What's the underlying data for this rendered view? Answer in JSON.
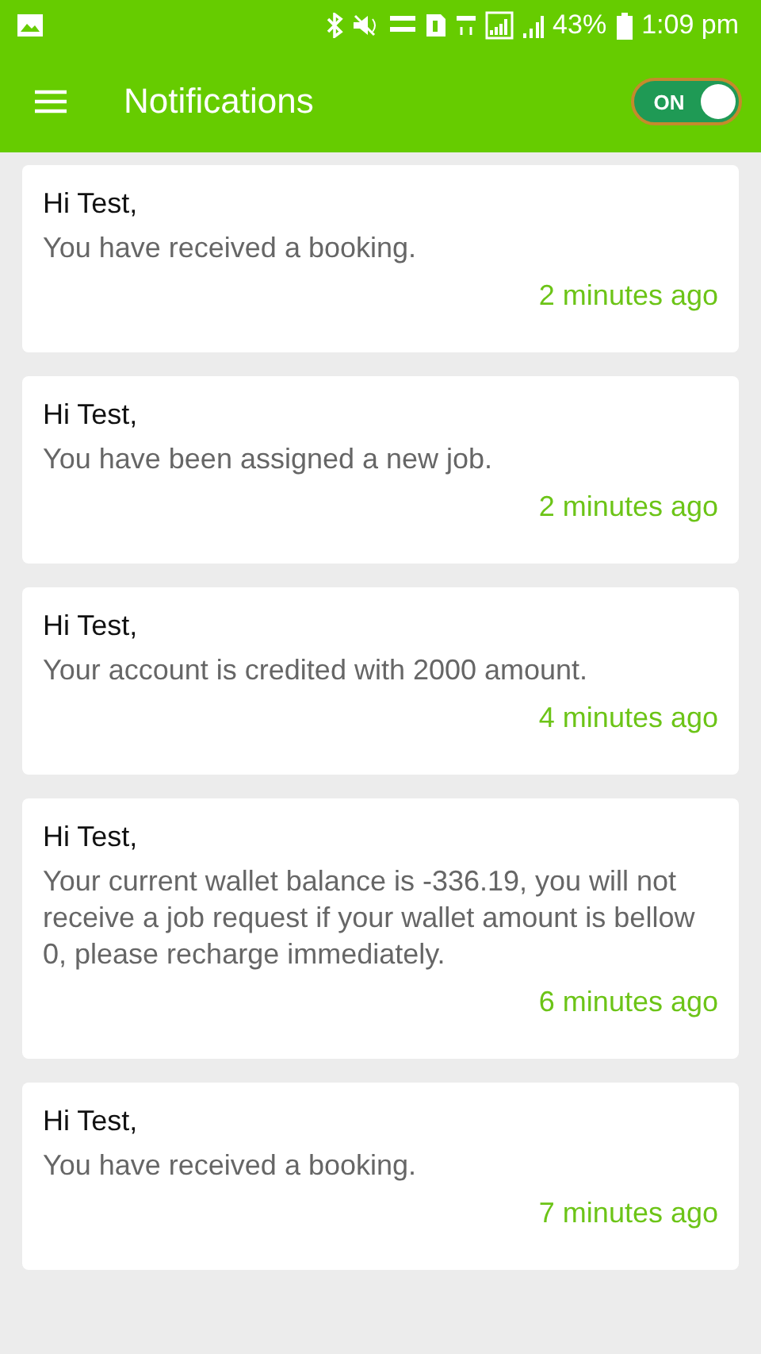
{
  "status_bar": {
    "battery": "43%",
    "time": "1:09 pm"
  },
  "app_bar": {
    "title": "Notifications",
    "toggle": {
      "label": "ON",
      "on": true
    }
  },
  "notifications": [
    {
      "greeting": "Hi Test,",
      "message": "You have received a booking.",
      "time": "2 minutes ago"
    },
    {
      "greeting": "Hi Test,",
      "message": "You have been assigned a new job.",
      "time": "2 minutes ago"
    },
    {
      "greeting": "Hi Test,",
      "message": "Your account is credited with 2000 amount.",
      "time": "4 minutes ago"
    },
    {
      "greeting": "Hi Test,",
      "message": "Your current wallet balance is -336.19, you will not receive a job request if your wallet amount is bellow 0, please recharge immediately.",
      "time": "6 minutes ago"
    },
    {
      "greeting": "Hi Test,",
      "message": "You have received a booking.",
      "time": "7 minutes ago"
    }
  ]
}
